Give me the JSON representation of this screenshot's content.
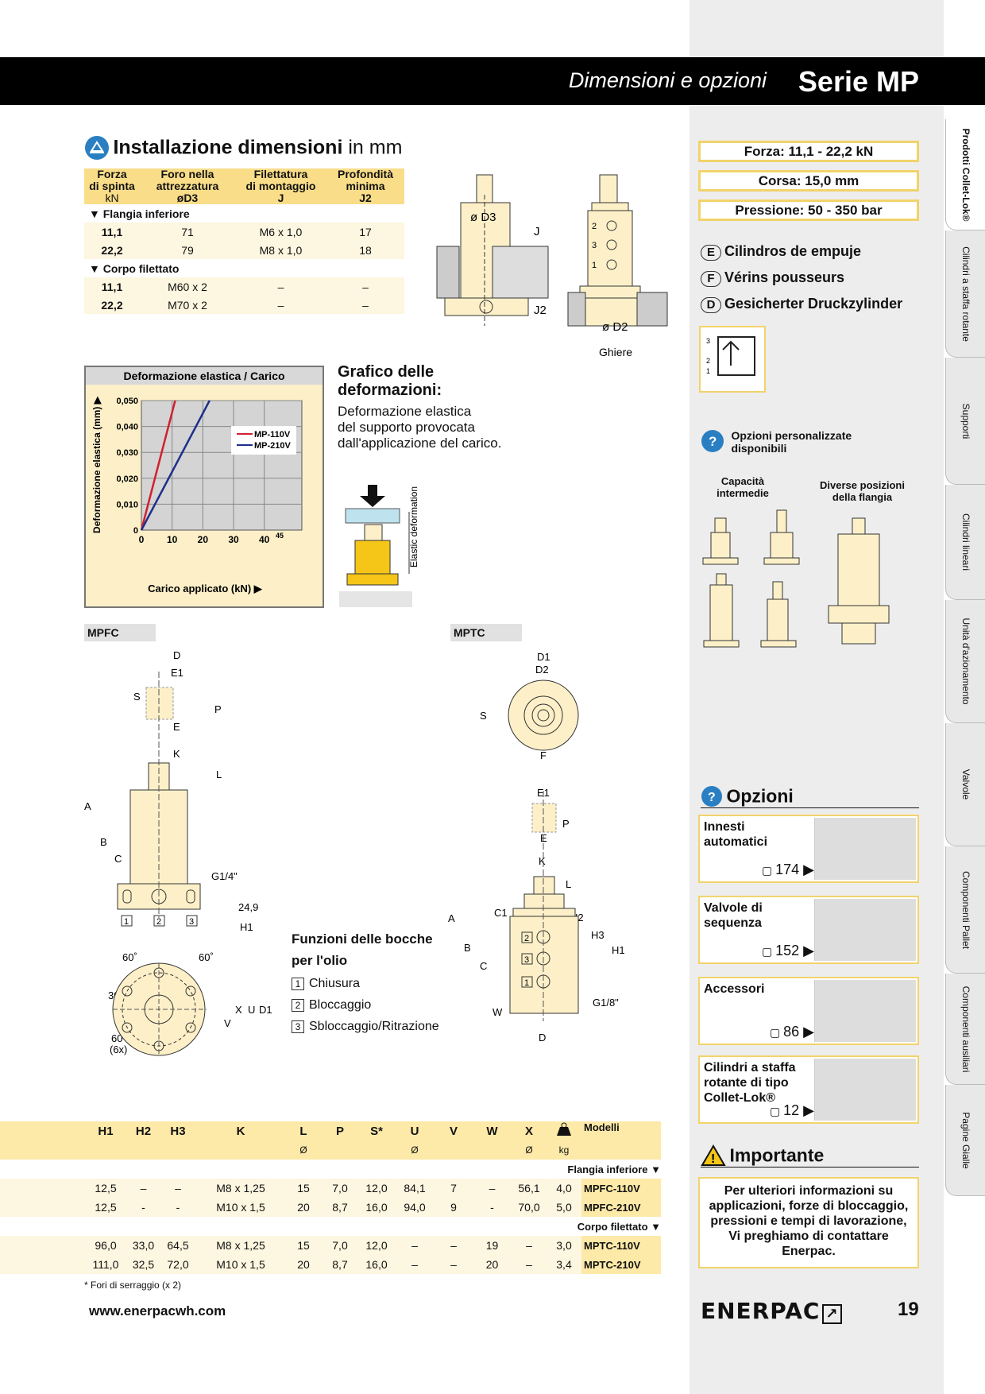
{
  "header": {
    "subtitle": "Dimensioni e opzioni",
    "series": "Serie MP"
  },
  "install": {
    "title": "Installazione dimensioni",
    "unit": "in mm",
    "columns": [
      {
        "l1": "Forza",
        "l2": "di spinta",
        "l3": "kN"
      },
      {
        "l1": "Foro nella",
        "l2": "attrezzatura",
        "l3": "øD3"
      },
      {
        "l1": "Filettatura",
        "l2": "di montaggio",
        "l3": "J"
      },
      {
        "l1": "Profondità",
        "l2": "minima",
        "l3": "J2"
      }
    ],
    "section1": "▼ Flangia inferiore",
    "rows1": [
      [
        "11,1",
        "71",
        "M6 x 1,0",
        "17"
      ],
      [
        "22,2",
        "79",
        "M8 x 1,0",
        "18"
      ]
    ],
    "section2": "▼ Corpo filettato",
    "rows2": [
      [
        "11,1",
        "M60 x 2",
        "–",
        "–"
      ],
      [
        "22,2",
        "M70 x 2",
        "–",
        "–"
      ]
    ]
  },
  "top_drawing": {
    "d3": "ø D3",
    "j": "J",
    "j2": "J2",
    "d2": "ø D2",
    "ghiere": "Ghiere",
    "p2": "2",
    "p3": "3",
    "p1": "1"
  },
  "specs": {
    "forza": "Forza:  11,1 - 22,2 kN",
    "corsa": "Corsa:  15,0 mm",
    "pressione": "Pressione:  50 - 350 bar"
  },
  "languages": [
    {
      "code": "E",
      "text": "Cilindros de empuje"
    },
    {
      "code": "F",
      "text": "Vérins pousseurs"
    },
    {
      "code": "D",
      "text": "Gesicherter Druckzylinder"
    }
  ],
  "custom": {
    "title": "Opzioni personalizzate disponibili",
    "col1": "Capacità intermedie",
    "col2": "Diverse posizioni della flangia"
  },
  "chart_data": {
    "type": "line",
    "title": "Deformazione elastica / Carico",
    "xlabel": "Carico applicato (kN) ▶",
    "ylabel": "Deformazione elastica (mm) ▶",
    "xlim": [
      0,
      45
    ],
    "ylim": [
      0,
      0.05
    ],
    "x_ticks": [
      "0",
      "10",
      "20",
      "30",
      "40",
      "45"
    ],
    "y_ticks": [
      "0",
      "0,010",
      "0,020",
      "0,030",
      "0,040",
      "0,050"
    ],
    "grid": true,
    "legend": "top-right",
    "series": [
      {
        "name": "MP-110V",
        "color": "#d0202f",
        "x": [
          0,
          11
        ],
        "y": [
          0,
          0.05
        ]
      },
      {
        "name": "MP-210V",
        "color": "#1e2f8a",
        "x": [
          0,
          22.2
        ],
        "y": [
          0,
          0.05
        ]
      }
    ]
  },
  "graph_text": {
    "title1": "Grafico delle",
    "title2": "deformazioni:",
    "desc1": "Deformazione elastica",
    "desc2": "del supporto provocata",
    "desc3": "dall'applicazione del carico.",
    "elastic": "Elastic deformation"
  },
  "mpfc": {
    "title": "MPFC",
    "D": "D",
    "E1": "E1",
    "S": "S",
    "P": "P",
    "E": "E",
    "K": "K",
    "L": "L",
    "A": "A",
    "B": "B",
    "C": "C",
    "G": "G1/4\"",
    "h": "24,9",
    "H1": "H1",
    "p1": "1",
    "p2": "2",
    "p3": "3",
    "a60a": "60˚",
    "a60b": "60˚",
    "a30": "30˚",
    "a60c": "60˚",
    "six": "(6x)",
    "X": "X",
    "U": "U",
    "D1": "D1",
    "V": "V"
  },
  "mptc": {
    "title": "MPTC",
    "D1": "D1",
    "D2": "D2",
    "S": "S",
    "F": "F",
    "E1": "E1",
    "P": "P",
    "E": "E",
    "K": "K",
    "L": "L",
    "C1": "C1",
    "H2": "H2",
    "H3": "H3",
    "H1": "H1",
    "A": "A",
    "B": "B",
    "C": "C",
    "G": "G1/8\"",
    "W": "W",
    "D": "D"
  },
  "oil": {
    "title1": "Funzioni delle bocche",
    "title2": "per l'olio",
    "items": [
      {
        "n": "1",
        "t": "Chiusura"
      },
      {
        "n": "2",
        "t": "Bloccaggio"
      },
      {
        "n": "3",
        "t": "Sbloccaggio/Ritrazione"
      }
    ]
  },
  "options": {
    "title": "Opzioni",
    "cards": [
      {
        "label": "Innesti automatici",
        "page": "174"
      },
      {
        "label": "Valvole di sequenza",
        "page": "152"
      },
      {
        "label": "Accessori",
        "page": "86"
      },
      {
        "label": "Cilindri a staffa rotante di tipo Collet-Lok®",
        "page": "12"
      }
    ]
  },
  "important": {
    "title": "Importante",
    "text": "Per ulteriori informazioni su applicazioni, forze di bloccaggio, pressioni e tempi di lavorazione, Vi preghiamo di contattare Enerpac."
  },
  "table": {
    "headers": [
      "H1",
      "H2",
      "H3",
      "K",
      "L",
      "P",
      "S*",
      "U",
      "V",
      "W",
      "X",
      "",
      "Modelli"
    ],
    "subheaders": [
      "",
      "",
      "",
      "",
      "Ø",
      "",
      "",
      "Ø",
      "",
      "",
      "Ø",
      "kg",
      ""
    ],
    "section1": "Flangia inferiore ▼",
    "rows1": [
      [
        "12,5",
        "–",
        "–",
        "M8 x 1,25",
        "15",
        "7,0",
        "12,0",
        "84,1",
        "7",
        "–",
        "56,1",
        "4,0",
        "MPFC-110V"
      ],
      [
        "12,5",
        "-",
        "-",
        "M10 x 1,5",
        "20",
        "8,7",
        "16,0",
        "94,0",
        "9",
        "-",
        "70,0",
        "5,0",
        "MPFC-210V"
      ]
    ],
    "section2": "Corpo filettato ▼",
    "rows2": [
      [
        "96,0",
        "33,0",
        "64,5",
        "M8 x 1,25",
        "15",
        "7,0",
        "12,0",
        "–",
        "–",
        "19",
        "–",
        "3,0",
        "MPTC-110V"
      ],
      [
        "111,0",
        "32,5",
        "72,0",
        "M10 x 1,5",
        "20",
        "8,7",
        "16,0",
        "–",
        "–",
        "20",
        "–",
        "3,4",
        "MPTC-210V"
      ]
    ],
    "footnote": "* Fori di serraggio (x 2)"
  },
  "footer": {
    "url": "www.enerpacwh.com",
    "brand": "ENERPAC",
    "page": "19"
  },
  "tabs": [
    "Prodotti Collet-Lok®",
    "Cilindri a staffa rotante",
    "Supporti",
    "Cilindri lineari",
    "Unità d'azionamento",
    "Valvole",
    "Componenti Pallet",
    "Componenti ausiliari",
    "Pagine Gialle"
  ]
}
